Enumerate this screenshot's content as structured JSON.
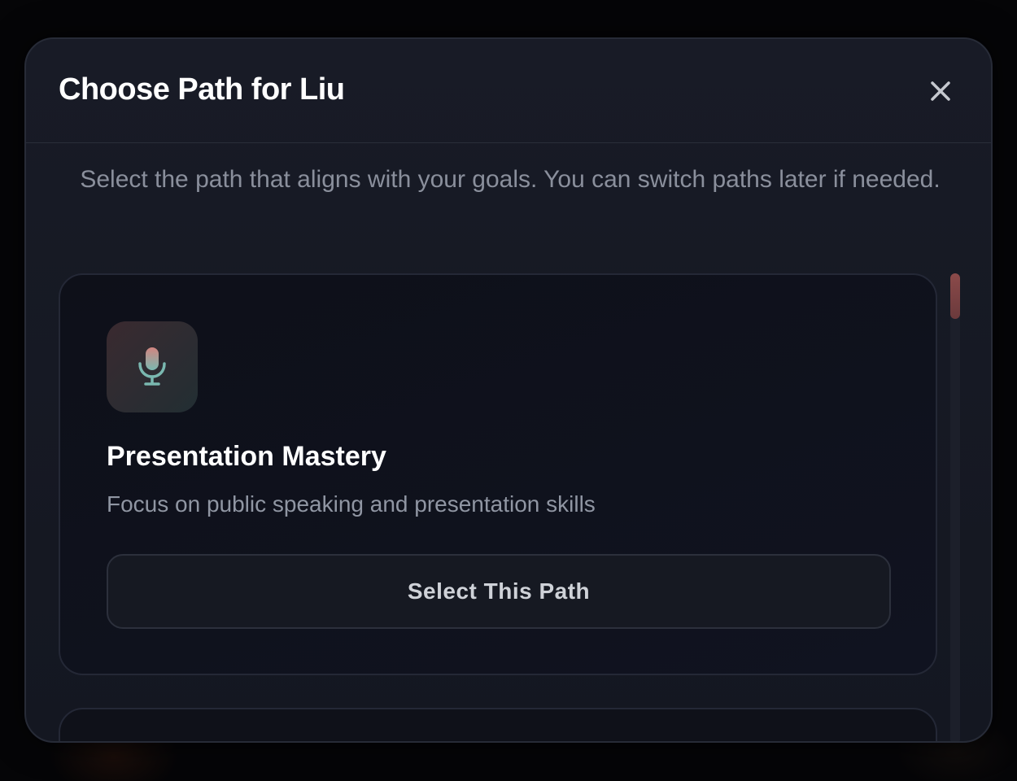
{
  "modal": {
    "title": "Choose Path for Liu",
    "subtitle": "Select the path that aligns with your goals. You can switch paths later if needed."
  },
  "paths": [
    {
      "icon": "microphone-icon",
      "title": "Presentation Mastery",
      "description": "Focus on public speaking and presentation skills",
      "button_label": "Select This Path"
    }
  ],
  "colors": {
    "accent_rose": "#c97a7a",
    "accent_teal": "#7ab8b0",
    "background": "#141721"
  }
}
